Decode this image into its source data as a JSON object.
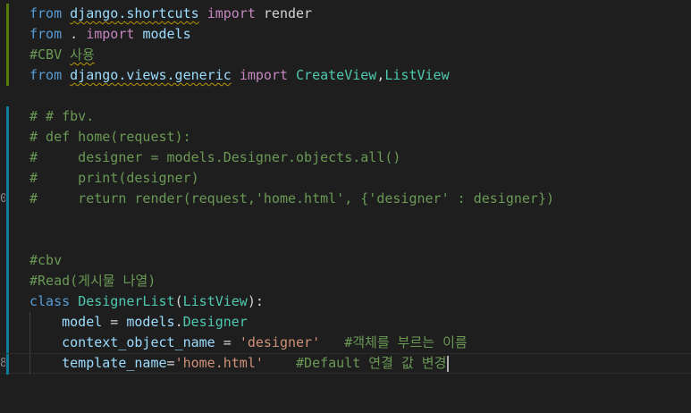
{
  "editor": {
    "line_numbers": [
      "",
      "",
      "",
      "",
      "",
      "",
      "",
      "",
      "",
      "0",
      "",
      "",
      "",
      "",
      "",
      "",
      "",
      "8"
    ],
    "gutter_marks": [
      "added",
      "added",
      "added",
      "added",
      "none",
      "modified",
      "modified",
      "modified",
      "modified",
      "modified",
      "modified",
      "modified",
      "modified",
      "modified",
      "modified",
      "modified",
      "modified",
      "modified"
    ],
    "lines": [
      [
        {
          "t": "kw",
          "v": "from"
        },
        {
          "t": "plain",
          "v": " "
        },
        {
          "t": "var",
          "v": "django.shortcuts",
          "sq": true
        },
        {
          "t": "plain",
          "v": " "
        },
        {
          "t": "ctrl",
          "v": "import"
        },
        {
          "t": "plain",
          "v": " render"
        }
      ],
      [
        {
          "t": "kw",
          "v": "from"
        },
        {
          "t": "plain",
          "v": " . "
        },
        {
          "t": "ctrl",
          "v": "import"
        },
        {
          "t": "plain",
          "v": " "
        },
        {
          "t": "var",
          "v": "models"
        }
      ],
      [
        {
          "t": "cmt",
          "v": "#CBV "
        },
        {
          "t": "cmt",
          "v": "사용",
          "sq": true
        }
      ],
      [
        {
          "t": "kw",
          "v": "from"
        },
        {
          "t": "plain",
          "v": " "
        },
        {
          "t": "var",
          "v": "django.views.generic",
          "sq": true
        },
        {
          "t": "plain",
          "v": " "
        },
        {
          "t": "ctrl",
          "v": "import"
        },
        {
          "t": "plain",
          "v": " "
        },
        {
          "t": "cls",
          "v": "CreateView"
        },
        {
          "t": "plain",
          "v": ","
        },
        {
          "t": "cls",
          "v": "ListView"
        }
      ],
      [],
      [
        {
          "t": "cmt",
          "v": "# # fbv."
        }
      ],
      [
        {
          "t": "cmt",
          "v": "# def home(request):"
        }
      ],
      [
        {
          "t": "cmt",
          "v": "#     designer = models.Designer.objects.all()"
        }
      ],
      [
        {
          "t": "cmt",
          "v": "#     print(designer)"
        }
      ],
      [
        {
          "t": "cmt",
          "v": "#     return render(request,'home.html', {'designer' : designer})"
        }
      ],
      [],
      [],
      [
        {
          "t": "cmt",
          "v": "#cbv"
        }
      ],
      [
        {
          "t": "cmt",
          "v": "#Read(게시물 나열)"
        }
      ],
      [
        {
          "t": "kw",
          "v": "class"
        },
        {
          "t": "plain",
          "v": " "
        },
        {
          "t": "cls",
          "v": "DesignerList"
        },
        {
          "t": "plain",
          "v": "("
        },
        {
          "t": "cls",
          "v": "ListView"
        },
        {
          "t": "plain",
          "v": "):"
        }
      ],
      [
        {
          "t": "plain",
          "v": "    "
        },
        {
          "t": "var",
          "v": "model"
        },
        {
          "t": "plain",
          "v": " = "
        },
        {
          "t": "var",
          "v": "models"
        },
        {
          "t": "plain",
          "v": "."
        },
        {
          "t": "cls",
          "v": "Designer"
        }
      ],
      [
        {
          "t": "plain",
          "v": "    "
        },
        {
          "t": "var",
          "v": "context_object_name"
        },
        {
          "t": "plain",
          "v": " = "
        },
        {
          "t": "str",
          "v": "'designer'"
        },
        {
          "t": "plain",
          "v": "   "
        },
        {
          "t": "cmt",
          "v": "#객체를 부르는 이름"
        }
      ],
      [
        {
          "t": "plain",
          "v": "    "
        },
        {
          "t": "var",
          "v": "template_name"
        },
        {
          "t": "plain",
          "v": "="
        },
        {
          "t": "str",
          "v": "'home.html'"
        },
        {
          "t": "plain",
          "v": "    "
        },
        {
          "t": "cmt",
          "v": "#Default 연결 값 변경"
        }
      ]
    ],
    "cursor_line": 17,
    "indent_guide_lines": [
      15,
      16,
      17
    ]
  }
}
